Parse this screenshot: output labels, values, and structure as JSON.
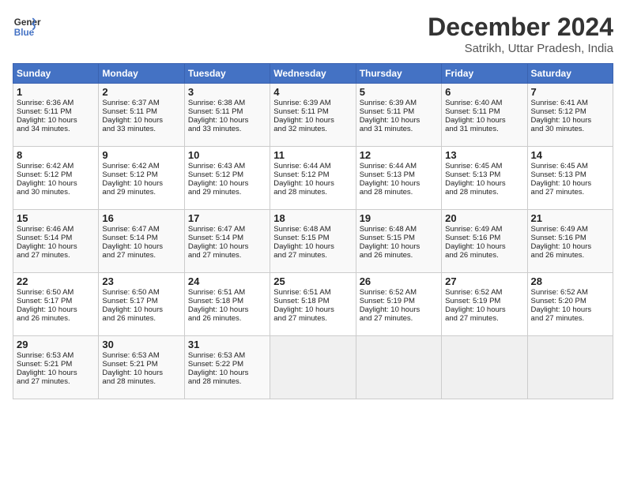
{
  "header": {
    "logo_line1": "General",
    "logo_line2": "Blue",
    "title": "December 2024",
    "subtitle": "Satrikh, Uttar Pradesh, India"
  },
  "days_of_week": [
    "Sunday",
    "Monday",
    "Tuesday",
    "Wednesday",
    "Thursday",
    "Friday",
    "Saturday"
  ],
  "weeks": [
    [
      {
        "day": "1",
        "info": "Sunrise: 6:36 AM\nSunset: 5:11 PM\nDaylight: 10 hours\nand 34 minutes."
      },
      {
        "day": "2",
        "info": "Sunrise: 6:37 AM\nSunset: 5:11 PM\nDaylight: 10 hours\nand 33 minutes."
      },
      {
        "day": "3",
        "info": "Sunrise: 6:38 AM\nSunset: 5:11 PM\nDaylight: 10 hours\nand 33 minutes."
      },
      {
        "day": "4",
        "info": "Sunrise: 6:39 AM\nSunset: 5:11 PM\nDaylight: 10 hours\nand 32 minutes."
      },
      {
        "day": "5",
        "info": "Sunrise: 6:39 AM\nSunset: 5:11 PM\nDaylight: 10 hours\nand 31 minutes."
      },
      {
        "day": "6",
        "info": "Sunrise: 6:40 AM\nSunset: 5:11 PM\nDaylight: 10 hours\nand 31 minutes."
      },
      {
        "day": "7",
        "info": "Sunrise: 6:41 AM\nSunset: 5:12 PM\nDaylight: 10 hours\nand 30 minutes."
      }
    ],
    [
      {
        "day": "8",
        "info": "Sunrise: 6:42 AM\nSunset: 5:12 PM\nDaylight: 10 hours\nand 30 minutes."
      },
      {
        "day": "9",
        "info": "Sunrise: 6:42 AM\nSunset: 5:12 PM\nDaylight: 10 hours\nand 29 minutes."
      },
      {
        "day": "10",
        "info": "Sunrise: 6:43 AM\nSunset: 5:12 PM\nDaylight: 10 hours\nand 29 minutes."
      },
      {
        "day": "11",
        "info": "Sunrise: 6:44 AM\nSunset: 5:12 PM\nDaylight: 10 hours\nand 28 minutes."
      },
      {
        "day": "12",
        "info": "Sunrise: 6:44 AM\nSunset: 5:13 PM\nDaylight: 10 hours\nand 28 minutes."
      },
      {
        "day": "13",
        "info": "Sunrise: 6:45 AM\nSunset: 5:13 PM\nDaylight: 10 hours\nand 28 minutes."
      },
      {
        "day": "14",
        "info": "Sunrise: 6:45 AM\nSunset: 5:13 PM\nDaylight: 10 hours\nand 27 minutes."
      }
    ],
    [
      {
        "day": "15",
        "info": "Sunrise: 6:46 AM\nSunset: 5:14 PM\nDaylight: 10 hours\nand 27 minutes."
      },
      {
        "day": "16",
        "info": "Sunrise: 6:47 AM\nSunset: 5:14 PM\nDaylight: 10 hours\nand 27 minutes."
      },
      {
        "day": "17",
        "info": "Sunrise: 6:47 AM\nSunset: 5:14 PM\nDaylight: 10 hours\nand 27 minutes."
      },
      {
        "day": "18",
        "info": "Sunrise: 6:48 AM\nSunset: 5:15 PM\nDaylight: 10 hours\nand 27 minutes."
      },
      {
        "day": "19",
        "info": "Sunrise: 6:48 AM\nSunset: 5:15 PM\nDaylight: 10 hours\nand 26 minutes."
      },
      {
        "day": "20",
        "info": "Sunrise: 6:49 AM\nSunset: 5:16 PM\nDaylight: 10 hours\nand 26 minutes."
      },
      {
        "day": "21",
        "info": "Sunrise: 6:49 AM\nSunset: 5:16 PM\nDaylight: 10 hours\nand 26 minutes."
      }
    ],
    [
      {
        "day": "22",
        "info": "Sunrise: 6:50 AM\nSunset: 5:17 PM\nDaylight: 10 hours\nand 26 minutes."
      },
      {
        "day": "23",
        "info": "Sunrise: 6:50 AM\nSunset: 5:17 PM\nDaylight: 10 hours\nand 26 minutes."
      },
      {
        "day": "24",
        "info": "Sunrise: 6:51 AM\nSunset: 5:18 PM\nDaylight: 10 hours\nand 26 minutes."
      },
      {
        "day": "25",
        "info": "Sunrise: 6:51 AM\nSunset: 5:18 PM\nDaylight: 10 hours\nand 27 minutes."
      },
      {
        "day": "26",
        "info": "Sunrise: 6:52 AM\nSunset: 5:19 PM\nDaylight: 10 hours\nand 27 minutes."
      },
      {
        "day": "27",
        "info": "Sunrise: 6:52 AM\nSunset: 5:19 PM\nDaylight: 10 hours\nand 27 minutes."
      },
      {
        "day": "28",
        "info": "Sunrise: 6:52 AM\nSunset: 5:20 PM\nDaylight: 10 hours\nand 27 minutes."
      }
    ],
    [
      {
        "day": "29",
        "info": "Sunrise: 6:53 AM\nSunset: 5:21 PM\nDaylight: 10 hours\nand 27 minutes."
      },
      {
        "day": "30",
        "info": "Sunrise: 6:53 AM\nSunset: 5:21 PM\nDaylight: 10 hours\nand 28 minutes."
      },
      {
        "day": "31",
        "info": "Sunrise: 6:53 AM\nSunset: 5:22 PM\nDaylight: 10 hours\nand 28 minutes."
      },
      {
        "day": "",
        "info": ""
      },
      {
        "day": "",
        "info": ""
      },
      {
        "day": "",
        "info": ""
      },
      {
        "day": "",
        "info": ""
      }
    ]
  ]
}
